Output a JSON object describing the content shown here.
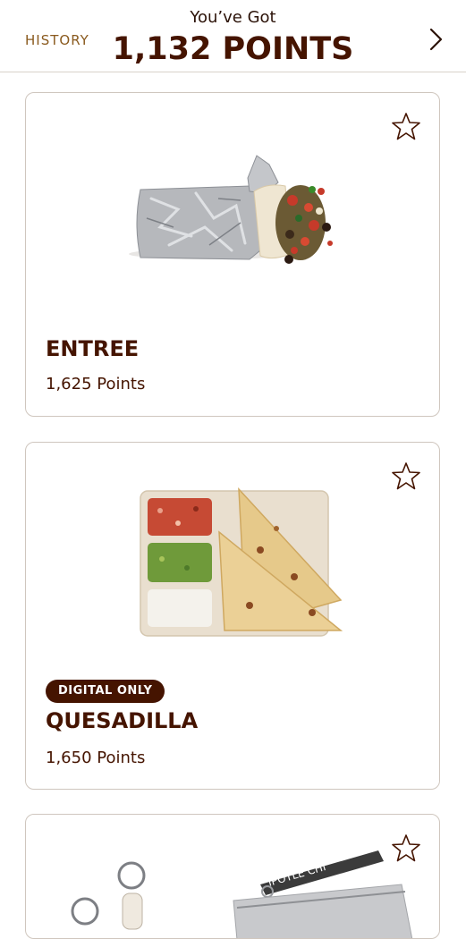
{
  "header": {
    "history_label": "HISTORY",
    "subtitle": "You’ve Got",
    "points_total": "1,132 POINTS",
    "next_icon": "chevron-right-icon"
  },
  "rewards": [
    {
      "name": "ENTREE",
      "points": "1,625 Points",
      "image": "burrito",
      "favorite_icon": "star-outline-icon"
    },
    {
      "name": "QUESADILLA",
      "points": "1,650 Points",
      "badge": "DIGITAL ONLY",
      "image": "quesadilla-tray",
      "favorite_icon": "star-outline-icon"
    },
    {
      "image": "keychain-and-pouch",
      "pouch_strap_text": "IPOTLE CHI",
      "favorite_icon": "star-outline-icon"
    }
  ],
  "colors": {
    "brand_brown": "#451400",
    "history_gold": "#8a5a1e",
    "card_border": "#cfc6be"
  }
}
